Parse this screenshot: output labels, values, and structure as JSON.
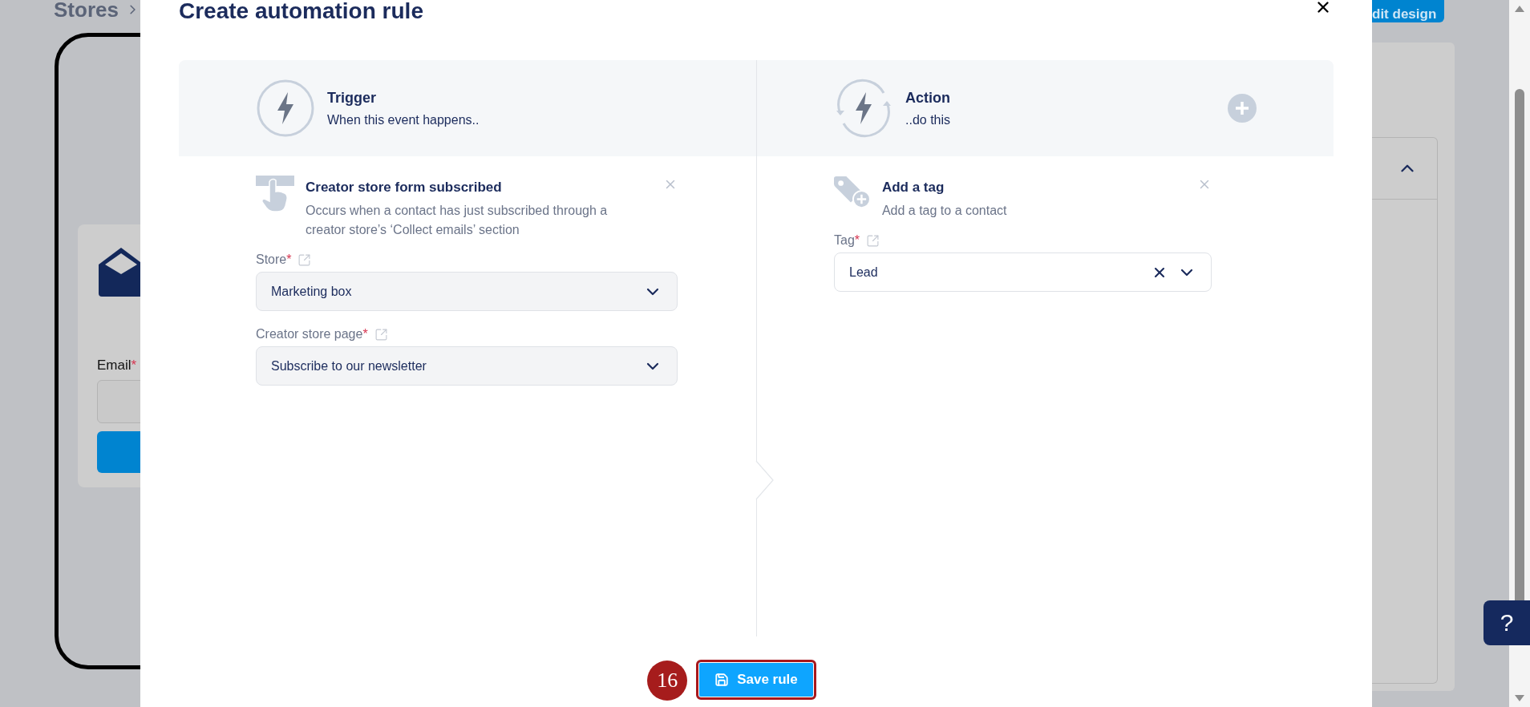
{
  "background": {
    "breadcrumb": "Stores",
    "edit_button": "dit design",
    "form": {
      "email_label": "Email",
      "required_mark": "*"
    }
  },
  "modal": {
    "title": "Create automation rule",
    "trigger": {
      "title": "Trigger",
      "subtitle": "When this event happens.."
    },
    "action": {
      "title": "Action",
      "subtitle": "..do this"
    },
    "trigger_item": {
      "title": "Creator store form subscribed",
      "description": "Occurs when a contact has just subscribed through a creator store’s ‘Collect emails’ section",
      "fields": [
        {
          "label": "Store",
          "required_mark": "*",
          "value": "Marketing box",
          "clearable": false
        },
        {
          "label": "Creator store page",
          "required_mark": "*",
          "value": "Subscribe to our newsletter",
          "clearable": false
        }
      ]
    },
    "action_item": {
      "title": "Add a tag",
      "description": "Add a tag to a contact",
      "fields": [
        {
          "label": "Tag",
          "required_mark": "*",
          "value": "Lead",
          "clearable": true
        }
      ]
    },
    "save_button": "Save rule",
    "step_badge": "16"
  },
  "help_button": "?"
}
